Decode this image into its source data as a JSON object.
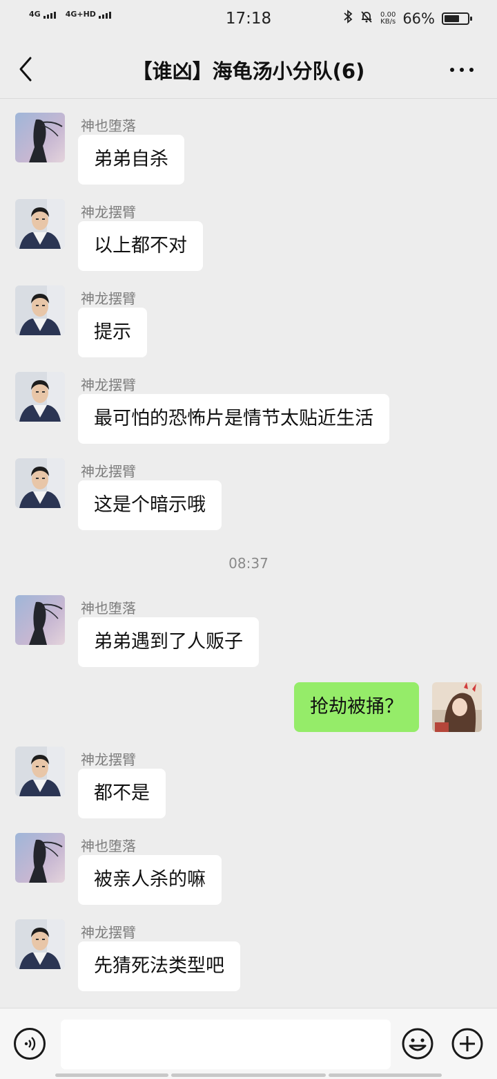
{
  "status_bar": {
    "network1": "4G",
    "network2": "4G+HD",
    "time": "17:18",
    "speed_value": "0.00",
    "speed_unit": "KB/s",
    "battery_pct": "66%",
    "battery_level": 0.66
  },
  "header": {
    "title": "【谁凶】海龟汤小分队(6)",
    "back_icon": "chevron-left-icon",
    "more_icon": "more-dots-icon"
  },
  "messages": [
    {
      "side": "left",
      "avatar": "avatar-a",
      "sender": "神也堕落",
      "text": "弟弟自杀"
    },
    {
      "side": "left",
      "avatar": "avatar-b",
      "sender": "神龙摆臂",
      "text": "以上都不对"
    },
    {
      "side": "left",
      "avatar": "avatar-b",
      "sender": "神龙摆臂",
      "text": "提示"
    },
    {
      "side": "left",
      "avatar": "avatar-b",
      "sender": "神龙摆臂",
      "text": "最可怕的恐怖片是情节太贴近生活"
    },
    {
      "side": "left",
      "avatar": "avatar-b",
      "sender": "神龙摆臂",
      "text": "这是个暗示哦"
    },
    {
      "side": "left",
      "avatar": "avatar-a",
      "sender": "神也堕落",
      "text": "弟弟遇到了人贩子"
    },
    {
      "side": "right",
      "avatar": "avatar-self",
      "sender": "",
      "text": "抢劫被捅？"
    },
    {
      "side": "left",
      "avatar": "avatar-b",
      "sender": "神龙摆臂",
      "text": "都不是"
    },
    {
      "side": "left",
      "avatar": "avatar-a",
      "sender": "神也堕落",
      "text": "被亲人杀的嘛"
    },
    {
      "side": "left",
      "avatar": "avatar-b",
      "sender": "神龙摆臂",
      "text": "先猜死法类型吧"
    }
  ],
  "timestamp": "08:37",
  "input_bar": {
    "voice_icon": "voice-icon",
    "input_value": "",
    "emoji_icon": "emoji-icon",
    "plus_icon": "plus-icon"
  },
  "colors": {
    "background": "#ededed",
    "bubble_in": "#ffffff",
    "bubble_out": "#95ec69"
  }
}
